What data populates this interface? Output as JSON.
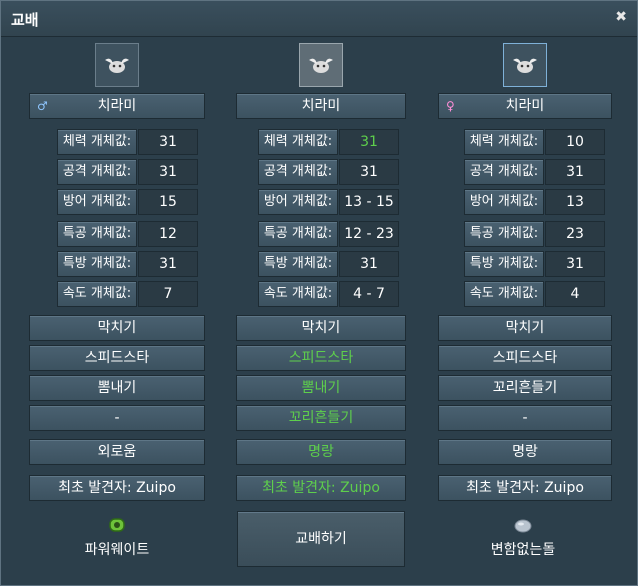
{
  "window": {
    "title": "교배",
    "close_symbol": "✖"
  },
  "colors": {
    "highlight_green": "#5ecf4c",
    "male_blue": "#8fc6ff",
    "female_pink": "#ff8ed8"
  },
  "parents": {
    "left": {
      "gender_symbol": "♂",
      "name": "치라미",
      "stats": [
        {
          "label": "체력 개체값:",
          "value": "31"
        },
        {
          "label": "공격 개체값:",
          "value": "31"
        },
        {
          "label": "방어 개체값:",
          "value": "15"
        },
        {
          "label": "특공 개체값:",
          "value": "12"
        },
        {
          "label": "특방 개체값:",
          "value": "31"
        },
        {
          "label": "속도 개체값:",
          "value": "7"
        }
      ],
      "moves": [
        "막치기",
        "스피드스타",
        "뽐내기",
        "-"
      ],
      "nature": "외로움",
      "discoverer": "최초 발견자: Zuipo",
      "held_item": {
        "name": "파워웨이트",
        "icon": "power-weight-icon"
      }
    },
    "child": {
      "name": "치라미",
      "stats": [
        {
          "label": "체력 개체값:",
          "value": "31"
        },
        {
          "label": "공격 개체값:",
          "value": "31"
        },
        {
          "label": "방어 개체값:",
          "value": "13 - 15"
        },
        {
          "label": "특공 개체값:",
          "value": "12 - 23"
        },
        {
          "label": "특방 개체값:",
          "value": "31"
        },
        {
          "label": "속도 개체값:",
          "value": "4 - 7"
        }
      ],
      "moves": [
        "막치기",
        "스피드스타",
        "뽐내기",
        "꼬리흔들기"
      ],
      "nature": "명랑",
      "discoverer": "최초 발견자: Zuipo",
      "action_label": "교배하기"
    },
    "right": {
      "gender_symbol": "♀",
      "name": "치라미",
      "stats": [
        {
          "label": "체력 개체값:",
          "value": "10"
        },
        {
          "label": "공격 개체값:",
          "value": "31"
        },
        {
          "label": "방어 개체값:",
          "value": "13"
        },
        {
          "label": "특공 개체값:",
          "value": "23"
        },
        {
          "label": "특방 개체값:",
          "value": "31"
        },
        {
          "label": "속도 개체값:",
          "value": "4"
        }
      ],
      "moves": [
        "막치기",
        "스피드스타",
        "꼬리흔들기",
        "-"
      ],
      "nature": "명랑",
      "discoverer": "최초 발견자: Zuipo",
      "held_item": {
        "name": "변함없는돌",
        "icon": "everstone-icon"
      }
    }
  }
}
